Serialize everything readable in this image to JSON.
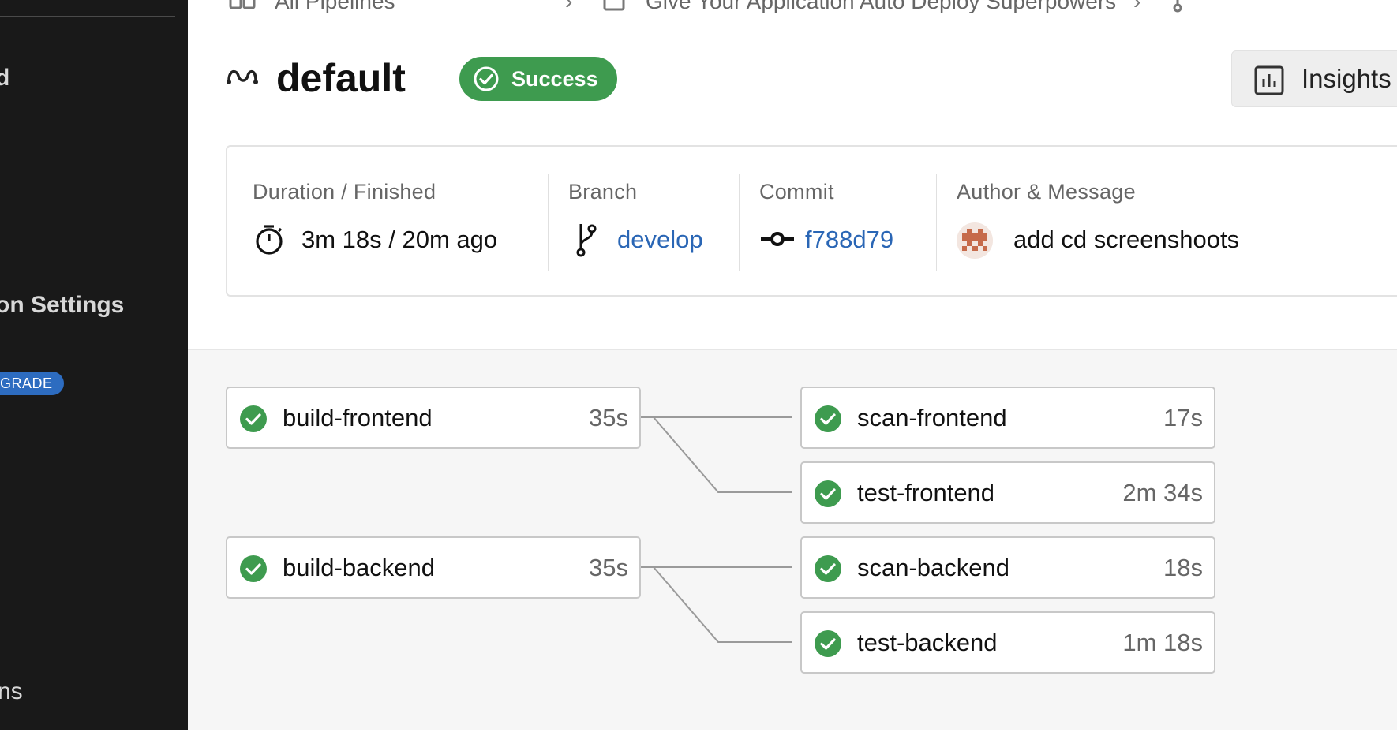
{
  "sidebar": {
    "item_partial_1": "d",
    "item_partial_2": "on Settings",
    "upgrade_badge": "GRADE",
    "item_partial_3": "ns"
  },
  "breadcrumb": {
    "items": [
      "All Pipelines",
      "Give Your Application Auto Deploy Superpowers"
    ],
    "separator": "›"
  },
  "header": {
    "pipeline_name": "default",
    "status": "Success",
    "insights_label": "Insights"
  },
  "info": {
    "duration_label": "Duration / Finished",
    "duration_value": "3m 18s / 20m ago",
    "branch_label": "Branch",
    "branch_value": "develop",
    "commit_label": "Commit",
    "commit_value": "f788d79",
    "author_label": "Author & Message",
    "message": "add cd screenshoots"
  },
  "steps": [
    {
      "name": "build-frontend",
      "duration": "35s",
      "status": "success"
    },
    {
      "name": "scan-frontend",
      "duration": "17s",
      "status": "success"
    },
    {
      "name": "test-frontend",
      "duration": "2m 34s",
      "status": "success"
    },
    {
      "name": "build-backend",
      "duration": "35s",
      "status": "success"
    },
    {
      "name": "scan-backend",
      "duration": "18s",
      "status": "success"
    },
    {
      "name": "test-backend",
      "duration": "1m 18s",
      "status": "success"
    }
  ],
  "colors": {
    "sidebar_bg": "#191919",
    "success_green": "#3e9b4f",
    "link_blue": "#2a66b5",
    "upgrade_blue": "#2d6cc0"
  }
}
